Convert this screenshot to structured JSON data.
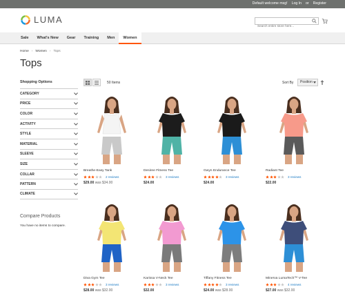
{
  "topbar": {
    "welcome": "Default welcome msg!",
    "login": "Log In",
    "or": "or",
    "register": "Register"
  },
  "header": {
    "logo_text": "LUMA",
    "search_placeholder": "Search entire store here...",
    "cart_icon": "cart-icon"
  },
  "nav": [
    "Sale",
    "What's New",
    "Gear",
    "Training",
    "Men",
    "Women"
  ],
  "nav_active": "Women",
  "breadcrumb": [
    "Home",
    "Women",
    "Tops"
  ],
  "page_title": "Tops",
  "sidebar": {
    "title": "Shopping Options",
    "filters": [
      "CATEGORY",
      "PRICE",
      "COLOR",
      "ACTIVITY",
      "STYLE",
      "MATERIAL",
      "SLEEVE",
      "SIZE",
      "COLLAR",
      "PATTERN",
      "CLIMATE"
    ]
  },
  "compare": {
    "title": "Compare Products",
    "text": "You have no items to compare."
  },
  "toolbar": {
    "count": "50 Items",
    "sort_label": "Sort By",
    "sort_value": "Position"
  },
  "products": [
    {
      "name": "Breathe-Easy Tank",
      "reviews": "2 reviews",
      "price": "$29.00",
      "was": "was $34.00",
      "rating": 3,
      "top": "#f4f4f4",
      "bottom": "#c9c9c9",
      "style": "tank"
    },
    {
      "name": "Desiree Fitness Tee",
      "reviews": "3 reviews",
      "price": "$24.00",
      "was": "",
      "rating": 3,
      "top": "#1c1c1c",
      "bottom": "#4fb3a6",
      "style": "tee"
    },
    {
      "name": "Gwyn Endurance Tee",
      "reviews": "3 reviews",
      "price": "$24.00",
      "was": "",
      "rating": 4,
      "top": "#1a1a1a",
      "bottom": "#2d8fd6",
      "style": "tee"
    },
    {
      "name": "Radiant Tee",
      "reviews": "3 reviews",
      "price": "$22.00",
      "was": "",
      "rating": 3,
      "top": "#f79a8a",
      "bottom": "#5a5a5a",
      "style": "tee"
    },
    {
      "name": "Diva Gym Tee",
      "reviews": "3 reviews",
      "price": "$28.00",
      "was": "was $32.00",
      "rating": 3,
      "top": "#f3e574",
      "bottom": "#1f63c6",
      "style": "tee"
    },
    {
      "name": "Karissa V-Neck Tee",
      "reviews": "3 reviews",
      "price": "$32.00",
      "was": "",
      "rating": 3,
      "top": "#f29ad1",
      "bottom": "#7a7a7a",
      "style": "tee"
    },
    {
      "name": "Tiffany Fitness Tee",
      "reviews": "3 reviews",
      "price": "$24.00",
      "was": "was $28.00",
      "rating": 4,
      "top": "#2c93e8",
      "bottom": "#7d7d7d",
      "style": "tee"
    },
    {
      "name": "Minerva LumaTech™ V-Tee",
      "reviews": "4 reviews",
      "price": "$27.00",
      "was": "was $32.00",
      "rating": 3,
      "top": "#3e4e7a",
      "bottom": "#2d8fd6",
      "style": "tee"
    }
  ],
  "colors": {
    "topbar": "#6e716e",
    "accent": "#ff5501",
    "link": "#1979c3",
    "star": "#ff5501"
  }
}
